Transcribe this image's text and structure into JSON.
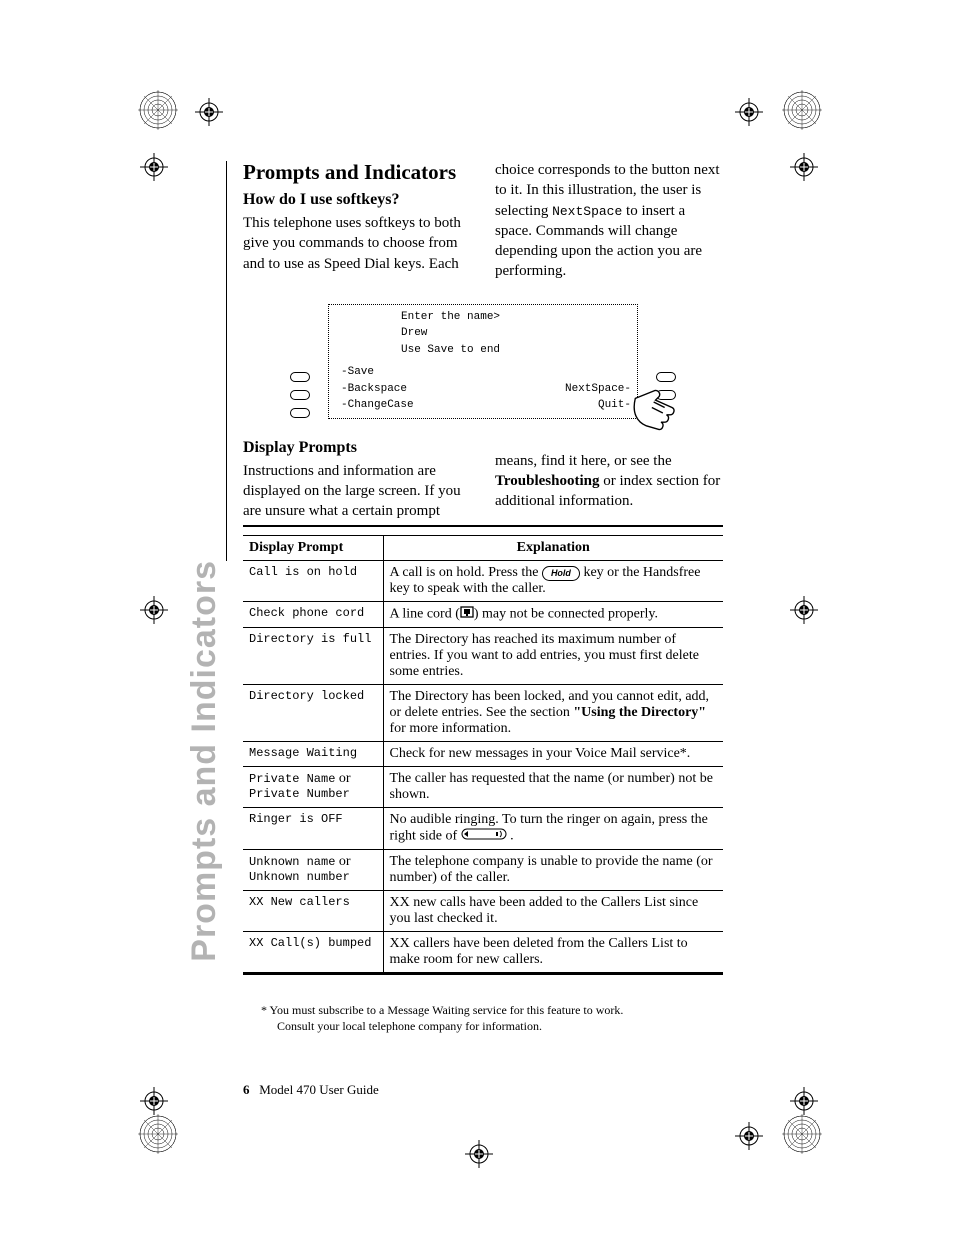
{
  "tab_label": "Prompts and Indicators",
  "h1": "Prompts and Indicators",
  "softkeys_heading": "How do I use softkeys?",
  "softkeys_para_left": "This telephone uses softkeys to both give you commands to choose from and to use as Speed Dial keys. Each",
  "softkeys_para_right_a": "choice corresponds to the button next to it. In this illustration, the user is selecting ",
  "softkeys_para_right_cmd": "NextSpace",
  "softkeys_para_right_b": " to insert a space. Commands will change depending upon the action you are performing.",
  "diagram": {
    "line1": "Enter the name>",
    "line2": "Drew",
    "line3": "Use Save to end",
    "sk_left": [
      "-Save",
      "-Backspace",
      "-ChangeCase"
    ],
    "sk_right": [
      "NextSpace-",
      "Quit-"
    ]
  },
  "display_heading": "Display Prompts",
  "display_para_left": "Instructions and information are displayed on the large screen. If you are unsure what a certain prompt",
  "display_para_right_a": "means, find it here, or see the ",
  "display_para_right_bold": "Troubleshooting",
  "display_para_right_b": " or index section for additional information.",
  "table": {
    "head_prompt": "Display Prompt",
    "head_explanation": "Explanation",
    "rows": [
      {
        "prompt": "Call is on hold",
        "exp_a": "A call is on hold. Press the ",
        "hold_label": "Hold",
        "exp_b": " key or the Handsfree key to speak with the caller."
      },
      {
        "prompt": "Check phone cord",
        "exp_a": "A line cord (",
        "exp_b": ") may not be connected properly."
      },
      {
        "prompt": "Directory is full",
        "exp": "The Directory has reached its maximum number of entries. If you want to add entries, you must first delete some entries."
      },
      {
        "prompt": "Directory locked",
        "exp_a": "The Directory has been locked, and you cannot edit, add, or delete entries. See the section ",
        "bold": "\"Using the Directory\"",
        "exp_b": " for more information."
      },
      {
        "prompt": "Message Waiting",
        "exp": "Check for new messages in your Voice Mail service*."
      },
      {
        "prompt_a": "Private Name",
        "prompt_or": " or ",
        "prompt_b": "Private Number",
        "exp": "The caller has requested that the name (or number) not be shown."
      },
      {
        "prompt": "Ringer is OFF",
        "exp_a": "No audible ringing. To turn the ringer on again, press the right side of ",
        "exp_b": " ."
      },
      {
        "prompt_a": "Unknown name",
        "prompt_or": " or ",
        "prompt_b": "Unknown number",
        "exp": "The telephone company is unable to provide the name (or number) of the caller."
      },
      {
        "prompt": "XX New callers",
        "exp": "XX new calls have been added to the Callers List since you last checked it."
      },
      {
        "prompt": "XX Call(s) bumped",
        "exp": "XX callers have been deleted from the Callers List to make room for new callers."
      }
    ]
  },
  "footnote_a": "* You must subscribe to a Message Waiting service for this feature to work. ",
  "footnote_b": "Consult your local telephone company for information.",
  "footer_page": "6",
  "footer_text": "Model 470 User Guide"
}
